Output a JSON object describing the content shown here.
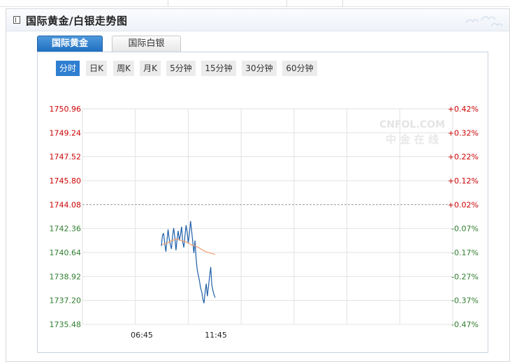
{
  "header": {
    "title": "国际黄金/白银走势图"
  },
  "tabs": [
    {
      "label": "国际黄金",
      "active": true
    },
    {
      "label": "国际白银",
      "active": false
    }
  ],
  "periods": [
    {
      "label": "分时",
      "active": true
    },
    {
      "label": "日K",
      "active": false
    },
    {
      "label": "周K",
      "active": false
    },
    {
      "label": "月K",
      "active": false
    },
    {
      "label": "5分钟",
      "active": false
    },
    {
      "label": "15分钟",
      "active": false
    },
    {
      "label": "30分钟",
      "active": false
    },
    {
      "label": "60分钟",
      "active": false
    }
  ],
  "watermark": {
    "top": "CNFOL.COM",
    "bottom": "中 金 在 线"
  },
  "colors": {
    "up": "#cc0000",
    "down": "#2e7d2e",
    "neutral": "#222222",
    "price_line": "#1f5fa8",
    "avg_line": "#f0a070",
    "grid": "#e2e2e2",
    "ref_line": "#9a9a9a"
  },
  "chart_data": {
    "type": "line",
    "reference_price": 1744.08,
    "ylim": [
      1735.48,
      1750.96
    ],
    "y_ticks": [
      "1750.96",
      "1749.24",
      "1747.52",
      "1745.80",
      "1744.08",
      "1742.36",
      "1740.64",
      "1738.92",
      "1737.20",
      "1735.48"
    ],
    "pct_ticks": [
      "+0.42%",
      "+0.32%",
      "+0.22%",
      "+0.12%",
      "+0.02%",
      "-0.07%",
      "-0.17%",
      "-0.27%",
      "-0.37%",
      "-0.47%"
    ],
    "x_labels": [
      "06:45",
      "11:45"
    ],
    "series": [
      {
        "values": [
          1741.1,
          1741.9,
          1742.0,
          1741.3,
          1740.7,
          1741.5,
          1742.3,
          1741.6,
          1741.2,
          1740.9,
          1741.8,
          1742.4,
          1741.7,
          1740.8,
          1741.6,
          1742.2,
          1741.5,
          1741.9,
          1742.5,
          1741.4,
          1741.0,
          1741.8,
          1742.6,
          1742.1,
          1741.3,
          1742.0,
          1742.9,
          1742.2,
          1741.4,
          1740.6,
          1741.5,
          1740.2,
          1739.4,
          1739.0,
          1738.6,
          1738.1,
          1737.8,
          1737.3,
          1737.0,
          1737.8,
          1738.4,
          1737.5,
          1738.2,
          1738.9,
          1739.6,
          1738.3,
          1737.9,
          1737.6,
          1737.4
        ]
      },
      {
        "values": [
          1741.2,
          1741.3,
          1741.5,
          1741.6,
          1741.5,
          1741.4,
          1741.2,
          1741.1,
          1740.9,
          1740.7,
          1740.6,
          1740.5
        ]
      }
    ]
  }
}
